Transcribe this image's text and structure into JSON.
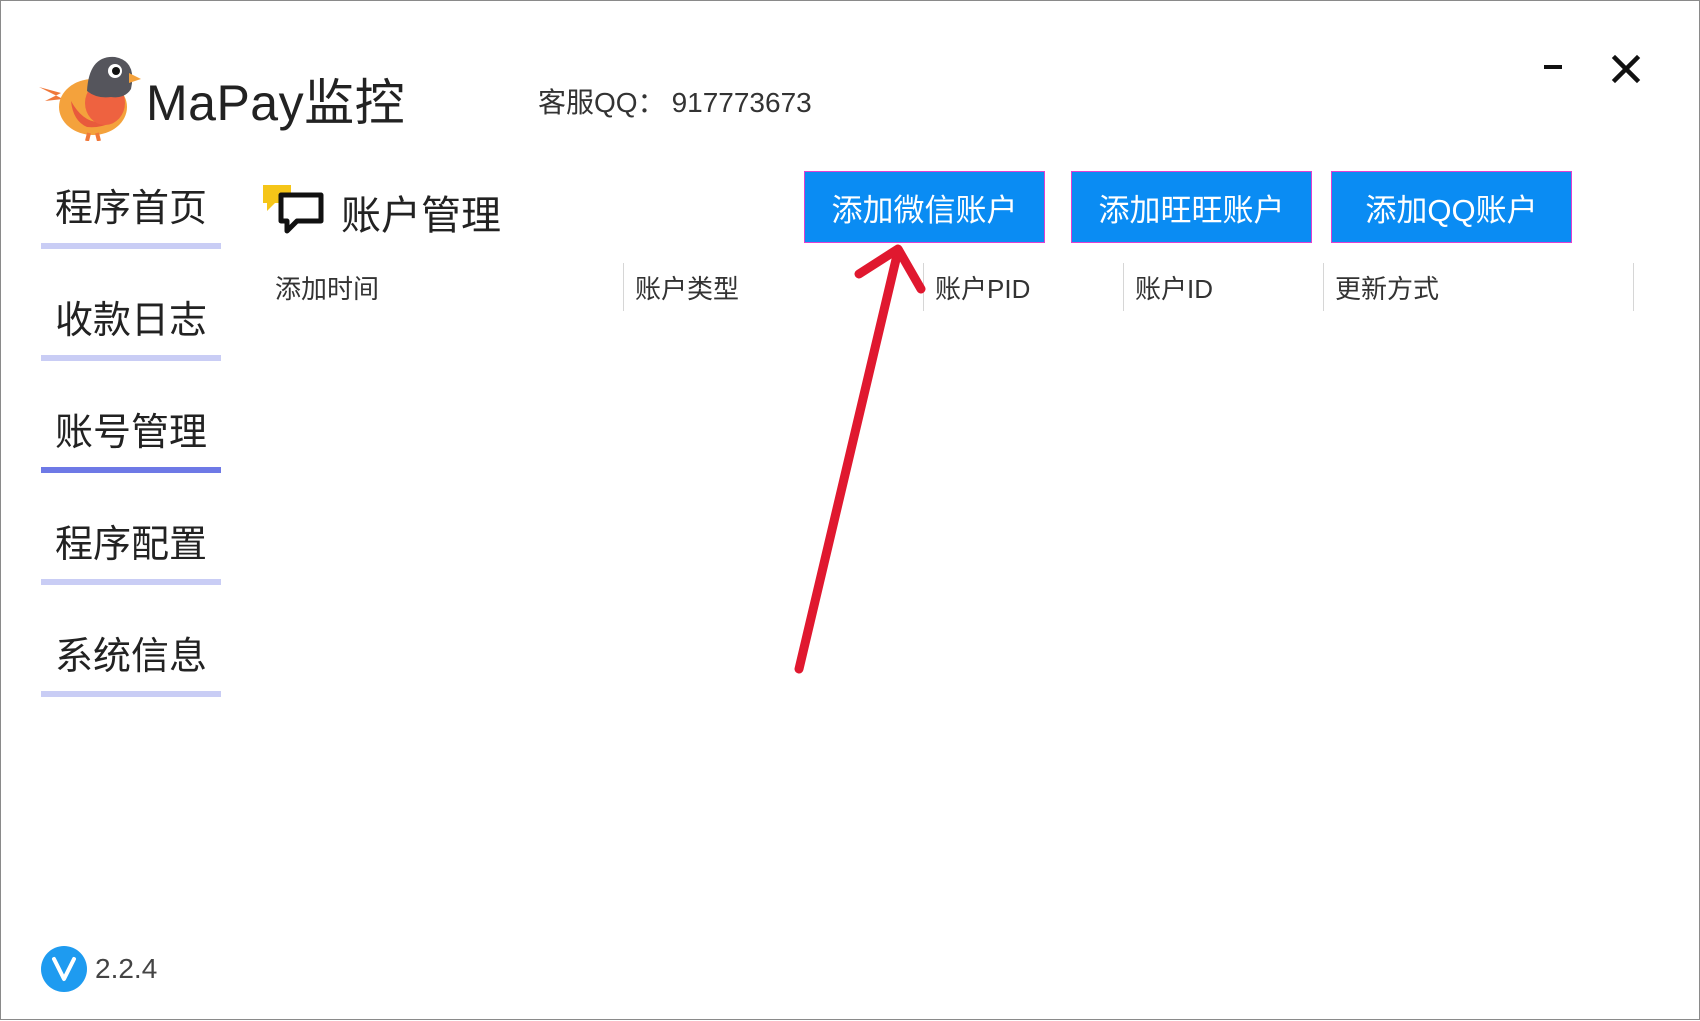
{
  "app": {
    "title": "MaPay监控",
    "service_label": "客服QQ：",
    "service_qq": "917773673",
    "version": "2.2.4"
  },
  "window_controls": {
    "minimize_icon": "minimize-icon",
    "close_icon": "close-icon"
  },
  "sidebar": {
    "items": [
      {
        "label": "程序首页",
        "active": false
      },
      {
        "label": "收款日志",
        "active": false
      },
      {
        "label": "账号管理",
        "active": true
      },
      {
        "label": "程序配置",
        "active": false
      },
      {
        "label": "系统信息",
        "active": false
      }
    ]
  },
  "main": {
    "section_title": "账户管理",
    "buttons": {
      "wechat": "添加微信账户",
      "wangwang": "添加旺旺账户",
      "qq": "添加QQ账户"
    },
    "table": {
      "columns": [
        "添加时间",
        "账户类型",
        "账户PID",
        "账户ID",
        "更新方式"
      ],
      "rows": []
    }
  },
  "colors": {
    "accent_button": "#0a8cf3",
    "nav_active": "#6e79e6",
    "nav_inactive": "#c9cdf5",
    "annotation_arrow": "#e0182f",
    "version_badge": "#1e9bf0"
  }
}
